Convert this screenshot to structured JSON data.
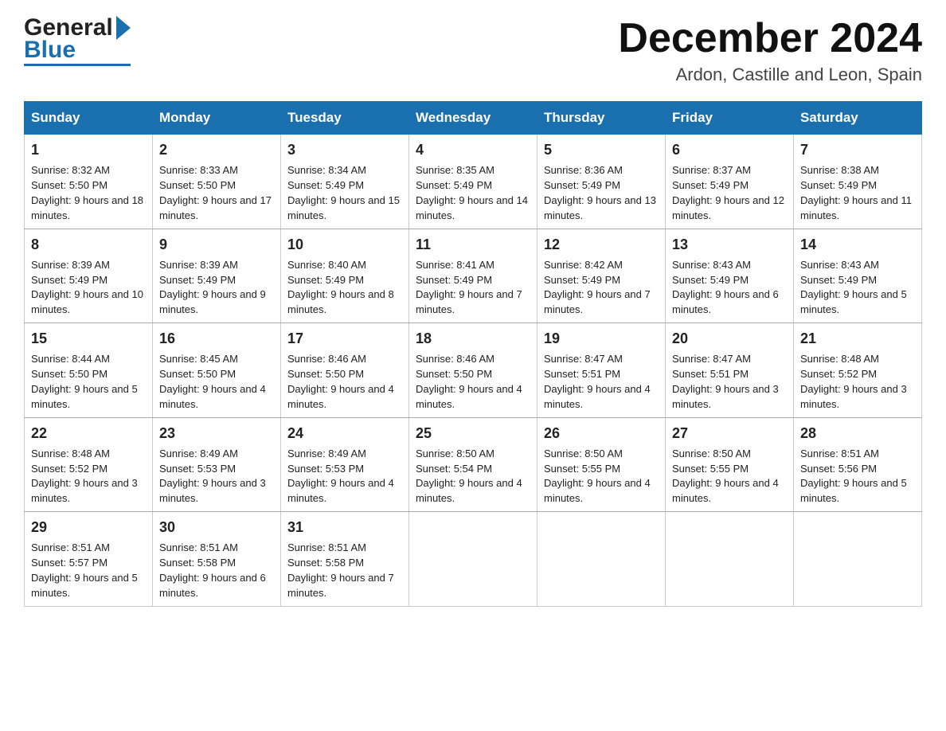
{
  "header": {
    "title": "December 2024",
    "subtitle": "Ardon, Castille and Leon, Spain",
    "logo_general": "General",
    "logo_blue": "Blue"
  },
  "calendar": {
    "days_of_week": [
      "Sunday",
      "Monday",
      "Tuesday",
      "Wednesday",
      "Thursday",
      "Friday",
      "Saturday"
    ],
    "weeks": [
      [
        {
          "day": "1",
          "sunrise": "8:32 AM",
          "sunset": "5:50 PM",
          "daylight": "9 hours and 18 minutes."
        },
        {
          "day": "2",
          "sunrise": "8:33 AM",
          "sunset": "5:50 PM",
          "daylight": "9 hours and 17 minutes."
        },
        {
          "day": "3",
          "sunrise": "8:34 AM",
          "sunset": "5:49 PM",
          "daylight": "9 hours and 15 minutes."
        },
        {
          "day": "4",
          "sunrise": "8:35 AM",
          "sunset": "5:49 PM",
          "daylight": "9 hours and 14 minutes."
        },
        {
          "day": "5",
          "sunrise": "8:36 AM",
          "sunset": "5:49 PM",
          "daylight": "9 hours and 13 minutes."
        },
        {
          "day": "6",
          "sunrise": "8:37 AM",
          "sunset": "5:49 PM",
          "daylight": "9 hours and 12 minutes."
        },
        {
          "day": "7",
          "sunrise": "8:38 AM",
          "sunset": "5:49 PM",
          "daylight": "9 hours and 11 minutes."
        }
      ],
      [
        {
          "day": "8",
          "sunrise": "8:39 AM",
          "sunset": "5:49 PM",
          "daylight": "9 hours and 10 minutes."
        },
        {
          "day": "9",
          "sunrise": "8:39 AM",
          "sunset": "5:49 PM",
          "daylight": "9 hours and 9 minutes."
        },
        {
          "day": "10",
          "sunrise": "8:40 AM",
          "sunset": "5:49 PM",
          "daylight": "9 hours and 8 minutes."
        },
        {
          "day": "11",
          "sunrise": "8:41 AM",
          "sunset": "5:49 PM",
          "daylight": "9 hours and 7 minutes."
        },
        {
          "day": "12",
          "sunrise": "8:42 AM",
          "sunset": "5:49 PM",
          "daylight": "9 hours and 7 minutes."
        },
        {
          "day": "13",
          "sunrise": "8:43 AM",
          "sunset": "5:49 PM",
          "daylight": "9 hours and 6 minutes."
        },
        {
          "day": "14",
          "sunrise": "8:43 AM",
          "sunset": "5:49 PM",
          "daylight": "9 hours and 5 minutes."
        }
      ],
      [
        {
          "day": "15",
          "sunrise": "8:44 AM",
          "sunset": "5:50 PM",
          "daylight": "9 hours and 5 minutes."
        },
        {
          "day": "16",
          "sunrise": "8:45 AM",
          "sunset": "5:50 PM",
          "daylight": "9 hours and 4 minutes."
        },
        {
          "day": "17",
          "sunrise": "8:46 AM",
          "sunset": "5:50 PM",
          "daylight": "9 hours and 4 minutes."
        },
        {
          "day": "18",
          "sunrise": "8:46 AM",
          "sunset": "5:50 PM",
          "daylight": "9 hours and 4 minutes."
        },
        {
          "day": "19",
          "sunrise": "8:47 AM",
          "sunset": "5:51 PM",
          "daylight": "9 hours and 4 minutes."
        },
        {
          "day": "20",
          "sunrise": "8:47 AM",
          "sunset": "5:51 PM",
          "daylight": "9 hours and 3 minutes."
        },
        {
          "day": "21",
          "sunrise": "8:48 AM",
          "sunset": "5:52 PM",
          "daylight": "9 hours and 3 minutes."
        }
      ],
      [
        {
          "day": "22",
          "sunrise": "8:48 AM",
          "sunset": "5:52 PM",
          "daylight": "9 hours and 3 minutes."
        },
        {
          "day": "23",
          "sunrise": "8:49 AM",
          "sunset": "5:53 PM",
          "daylight": "9 hours and 3 minutes."
        },
        {
          "day": "24",
          "sunrise": "8:49 AM",
          "sunset": "5:53 PM",
          "daylight": "9 hours and 4 minutes."
        },
        {
          "day": "25",
          "sunrise": "8:50 AM",
          "sunset": "5:54 PM",
          "daylight": "9 hours and 4 minutes."
        },
        {
          "day": "26",
          "sunrise": "8:50 AM",
          "sunset": "5:55 PM",
          "daylight": "9 hours and 4 minutes."
        },
        {
          "day": "27",
          "sunrise": "8:50 AM",
          "sunset": "5:55 PM",
          "daylight": "9 hours and 4 minutes."
        },
        {
          "day": "28",
          "sunrise": "8:51 AM",
          "sunset": "5:56 PM",
          "daylight": "9 hours and 5 minutes."
        }
      ],
      [
        {
          "day": "29",
          "sunrise": "8:51 AM",
          "sunset": "5:57 PM",
          "daylight": "9 hours and 5 minutes."
        },
        {
          "day": "30",
          "sunrise": "8:51 AM",
          "sunset": "5:58 PM",
          "daylight": "9 hours and 6 minutes."
        },
        {
          "day": "31",
          "sunrise": "8:51 AM",
          "sunset": "5:58 PM",
          "daylight": "9 hours and 7 minutes."
        },
        null,
        null,
        null,
        null
      ]
    ]
  },
  "labels": {
    "sunrise_prefix": "Sunrise: ",
    "sunset_prefix": "Sunset: ",
    "daylight_prefix": "Daylight: "
  }
}
